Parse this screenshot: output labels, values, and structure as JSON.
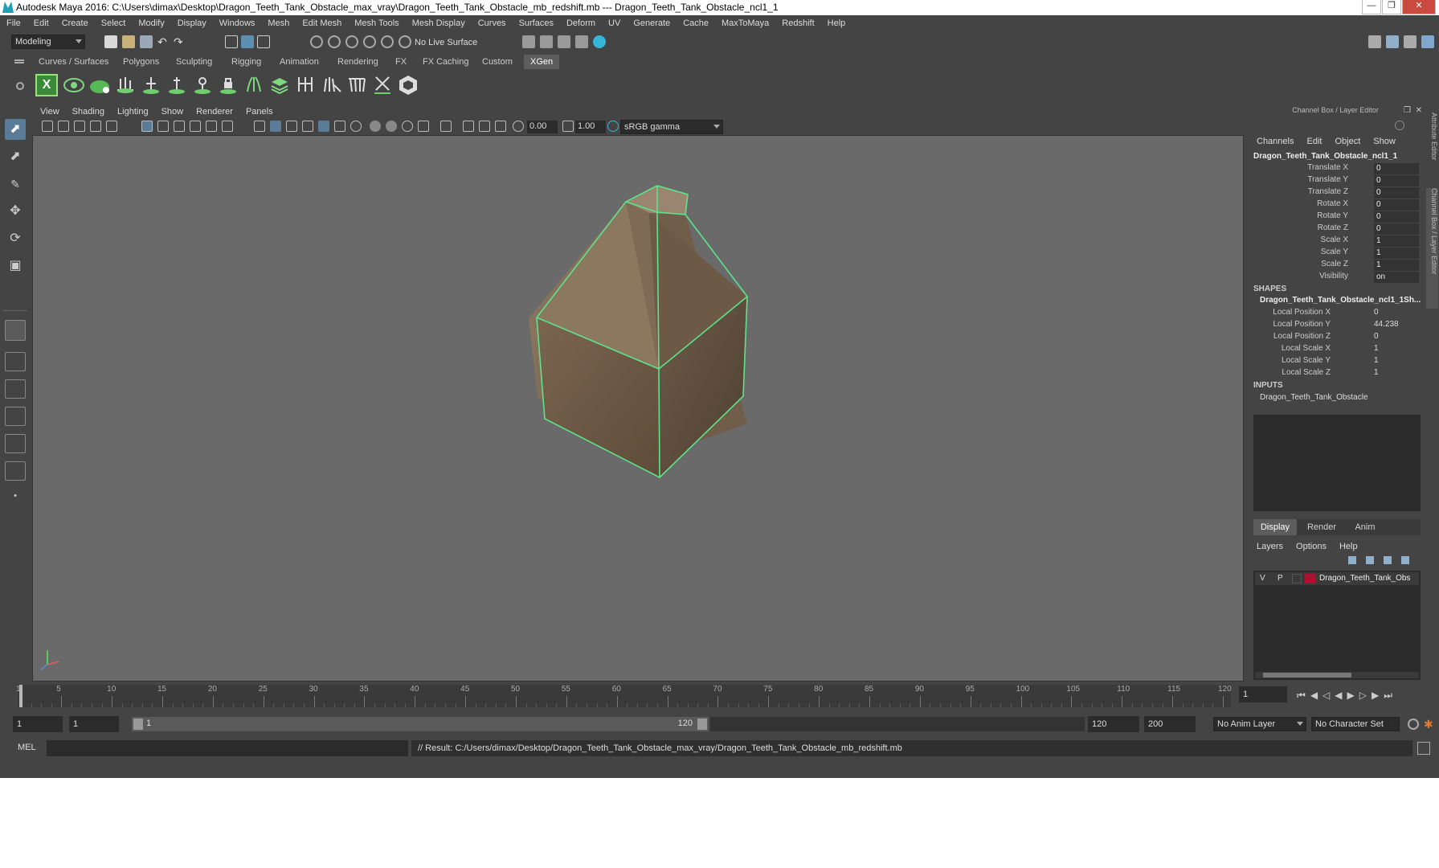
{
  "titlebar": {
    "title": "Autodesk Maya 2016: C:\\Users\\dimax\\Desktop\\Dragon_Teeth_Tank_Obstacle_max_vray\\Dragon_Teeth_Tank_Obstacle_mb_redshift.mb   ---   Dragon_Teeth_Tank_Obstacle_ncl1_1"
  },
  "menubar": [
    "File",
    "Edit",
    "Create",
    "Select",
    "Modify",
    "Display",
    "Windows",
    "Mesh",
    "Edit Mesh",
    "Mesh Tools",
    "Mesh Display",
    "Curves",
    "Surfaces",
    "Deform",
    "UV",
    "Generate",
    "Cache",
    "MaxToMaya",
    "Redshift",
    "Help"
  ],
  "statusline": {
    "mode": "Modeling",
    "live_surface": "No Live Surface"
  },
  "shelf": {
    "tabs": [
      "Curves / Surfaces",
      "Polygons",
      "Sculpting",
      "Rigging",
      "Animation",
      "Rendering",
      "FX",
      "FX Caching",
      "Custom",
      "XGen"
    ],
    "active": "XGen"
  },
  "viewport": {
    "menu": [
      "View",
      "Shading",
      "Lighting",
      "Show",
      "Renderer",
      "Panels"
    ],
    "exposure": "0.00",
    "gamma": "1.00",
    "color_space": "sRGB gamma",
    "camera": "side"
  },
  "channelbox": {
    "header": "Channel Box / Layer Editor",
    "menu": [
      "Channels",
      "Edit",
      "Object",
      "Show"
    ],
    "object_name": "Dragon_Teeth_Tank_Obstacle_ncl1_1",
    "attributes": [
      {
        "name": "Translate X",
        "value": "0"
      },
      {
        "name": "Translate Y",
        "value": "0"
      },
      {
        "name": "Translate Z",
        "value": "0"
      },
      {
        "name": "Rotate X",
        "value": "0"
      },
      {
        "name": "Rotate Y",
        "value": "0"
      },
      {
        "name": "Rotate Z",
        "value": "0"
      },
      {
        "name": "Scale X",
        "value": "1"
      },
      {
        "name": "Scale Y",
        "value": "1"
      },
      {
        "name": "Scale Z",
        "value": "1"
      },
      {
        "name": "Visibility",
        "value": "on"
      }
    ],
    "shapes_label": "SHAPES",
    "shape_name": "Dragon_Teeth_Tank_Obstacle_ncl1_1Sh...",
    "shape_attributes": [
      {
        "name": "Local Position X",
        "value": "0"
      },
      {
        "name": "Local Position Y",
        "value": "44.238"
      },
      {
        "name": "Local Position Z",
        "value": "0"
      },
      {
        "name": "Local Scale X",
        "value": "1"
      },
      {
        "name": "Local Scale Y",
        "value": "1"
      },
      {
        "name": "Local Scale Z",
        "value": "1"
      }
    ],
    "inputs_label": "INPUTS",
    "input_name": "Dragon_Teeth_Tank_Obstacle"
  },
  "layer_editor": {
    "tabs": [
      "Display",
      "Render",
      "Anim"
    ],
    "active_tab": "Display",
    "menu": [
      "Layers",
      "Options",
      "Help"
    ],
    "layer": {
      "v": "V",
      "p": "P",
      "name": "Dragon_Teeth_Tank_Obs",
      "color": "#b01030"
    }
  },
  "side_tabs": [
    "Attribute Editor",
    "Channel Box / Layer Editor"
  ],
  "timeline": {
    "labels": [
      "1",
      "5",
      "10",
      "15",
      "20",
      "25",
      "30",
      "35",
      "40",
      "45",
      "50",
      "55",
      "60",
      "65",
      "70",
      "75",
      "80",
      "85",
      "90",
      "95",
      "100",
      "105",
      "110",
      "115",
      "120"
    ],
    "current_frame": "1"
  },
  "range": {
    "start": "1",
    "anim_start": "1",
    "slider_start": "1",
    "slider_end": "120",
    "end": "120",
    "anim_end": "200",
    "anim_layer": "No Anim Layer",
    "character_set": "No Character Set"
  },
  "command": {
    "language": "MEL",
    "result": "// Result: C:/Users/dimax/Desktop/Dragon_Teeth_Tank_Obstacle_max_vray/Dragon_Teeth_Tank_Obstacle_mb_redshift.mb"
  },
  "colors": {
    "accent": "#5dcfd9",
    "selection": "#5de38a",
    "panel": "#444444",
    "viewport_bg": "#6a6a6a"
  }
}
